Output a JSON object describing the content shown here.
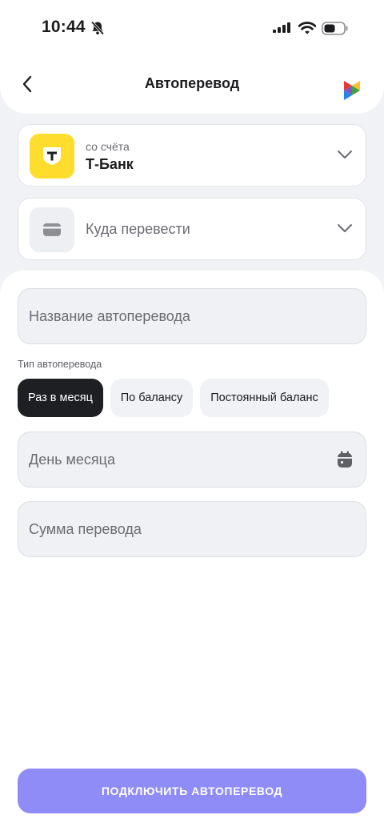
{
  "status_bar": {
    "time": "10:44"
  },
  "header": {
    "title": "Автоперевод"
  },
  "from_account": {
    "sub_label": "со счёта",
    "bank_name": "Т-Банк",
    "bank_logo_letter": "T"
  },
  "to_account": {
    "placeholder": "Куда перевести"
  },
  "form": {
    "name_placeholder": "Название автоперевода",
    "type_label": "Тип автоперевода",
    "types": [
      {
        "label": "Раз в месяц",
        "selected": true
      },
      {
        "label": "По балансу",
        "selected": false
      },
      {
        "label": "Постоянный баланс",
        "selected": false
      }
    ],
    "day_placeholder": "День месяца",
    "amount_placeholder": "Сумма перевода"
  },
  "submit": {
    "label": "ПОДКЛЮЧИТЬ АВТОПЕРЕВОД"
  },
  "colors": {
    "accent": "#8f8cf8",
    "tbank_yellow": "#ffdd2d",
    "selected_chip": "#1e1f22",
    "background": "#f1f2f5"
  },
  "icons": [
    "bell-off-icon",
    "signal-icon",
    "wifi-icon",
    "battery-icon",
    "back-arrow-icon",
    "app-logo-icon",
    "chevron-down-icon",
    "card-icon",
    "calendar-icon"
  ]
}
